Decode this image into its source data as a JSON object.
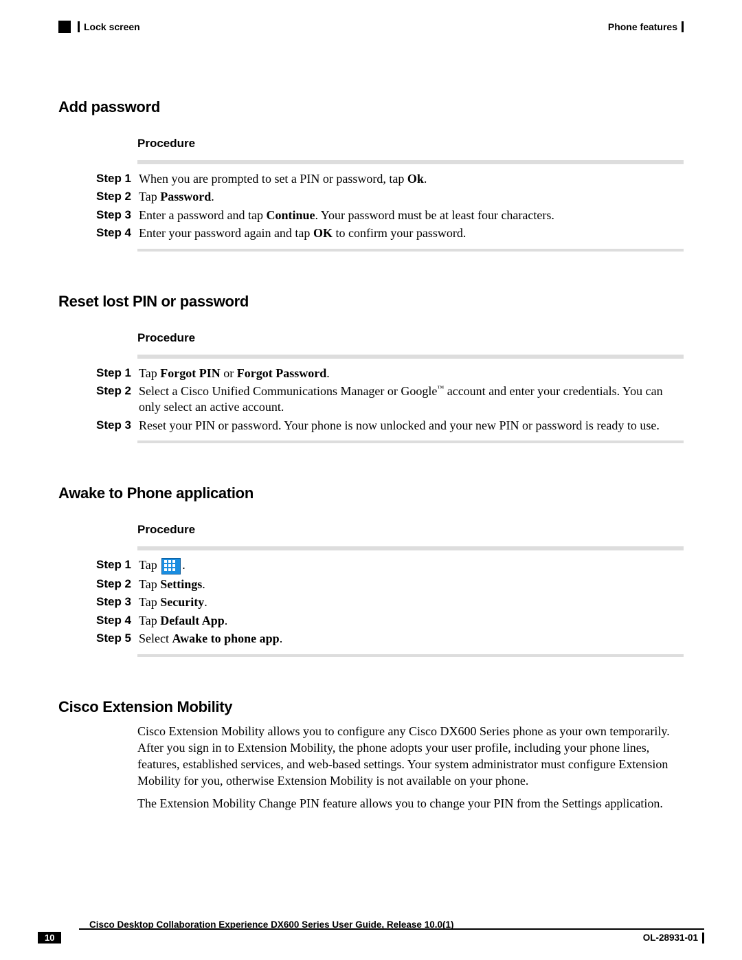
{
  "header": {
    "left": "Lock screen",
    "right": "Phone features"
  },
  "sections": {
    "add_password": {
      "heading": "Add password",
      "procedure_label": "Procedure",
      "steps": [
        {
          "label": "Step 1",
          "pre": "When you are prompted to set a PIN or password, tap ",
          "b1": "Ok",
          "post": "."
        },
        {
          "label": "Step 2",
          "pre": "Tap ",
          "b1": "Password",
          "post": "."
        },
        {
          "label": "Step 3",
          "pre": "Enter a password and tap ",
          "b1": "Continue",
          "post": ". Your password must be at least four characters."
        },
        {
          "label": "Step 4",
          "pre": "Enter your password again and tap ",
          "b1": "OK",
          "post": " to confirm your password."
        }
      ]
    },
    "reset_pin": {
      "heading": "Reset lost PIN or password",
      "procedure_label": "Procedure",
      "steps": [
        {
          "label": "Step 1",
          "pre": "Tap ",
          "b1": "Forgot PIN",
          "mid": " or ",
          "b2": "Forgot Password",
          "post": "."
        },
        {
          "label": "Step 2",
          "pre": "Select a Cisco Unified Communications Manager or Google",
          "tm": "™",
          "post": " account and enter your credentials. You can only select an active account."
        },
        {
          "label": "Step 3",
          "pre": "Reset your PIN or password. Your phone is now unlocked and your new PIN or password is ready to use."
        }
      ]
    },
    "awake": {
      "heading": "Awake to Phone application",
      "procedure_label": "Procedure",
      "steps": [
        {
          "label": "Step 1",
          "pre": "Tap ",
          "icon": true,
          "post": "."
        },
        {
          "label": "Step 2",
          "pre": "Tap ",
          "b1": "Settings",
          "post": "."
        },
        {
          "label": "Step 3",
          "pre": "Tap ",
          "b1": "Security",
          "post": "."
        },
        {
          "label": "Step 4",
          "pre": "Tap ",
          "b1": "Default App",
          "post": "."
        },
        {
          "label": "Step 5",
          "pre": "Select ",
          "b1": "Awake to phone app",
          "post": "."
        }
      ]
    },
    "extension_mobility": {
      "heading": "Cisco Extension Mobility",
      "para1": "Cisco Extension Mobility allows you to configure any Cisco DX600 Series phone as your own temporarily. After you sign in to Extension Mobility, the phone adopts your user profile, including your phone lines, features, established services, and web-based settings. Your system administrator must configure Extension Mobility for you, otherwise Extension Mobility is not available on your phone.",
      "para2": "The Extension Mobility Change PIN feature allows you to change your PIN from the Settings application."
    }
  },
  "footer": {
    "title": "Cisco Desktop Collaboration Experience DX600 Series User Guide, Release 10.0(1)",
    "page_num": "10",
    "doc_id": "OL-28931-01"
  }
}
